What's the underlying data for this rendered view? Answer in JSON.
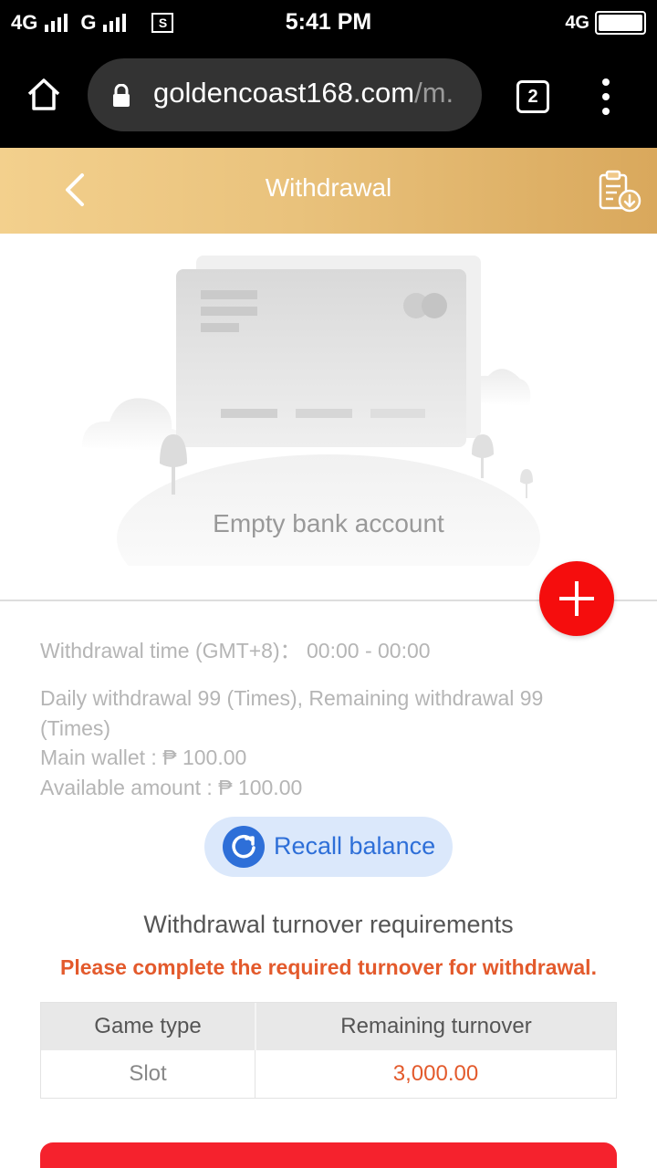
{
  "status_bar": {
    "net1": "4G",
    "net2": "G",
    "sim_label": "S",
    "time": "5:41 PM",
    "net_right": "4G"
  },
  "browser": {
    "url_main": "goldencoast168.com",
    "url_tail": "/m.",
    "tab_count": "2",
    "icons": [
      "home-icon",
      "lock-icon",
      "tabs-icon",
      "more-vert-icon"
    ]
  },
  "header": {
    "title": "Withdrawal",
    "icons": [
      "chevron-left-icon",
      "clipboard-download-icon"
    ],
    "gradient": [
      "#f3d08d",
      "#d9a85c"
    ]
  },
  "empty_state": {
    "text": "Empty bank account"
  },
  "add_button": {
    "icon": "plus-icon",
    "color": "#f50d0d"
  },
  "info": {
    "withdrawal_time": "Withdrawal time (GMT+8)：  00:00 - 00:00",
    "daily_limit": "Daily withdrawal 99 (Times), Remaining withdrawal 99 (Times)",
    "main_wallet": "Main wallet : ₱ 100.00",
    "available_amount": "Available amount : ₱ 100.00"
  },
  "recall": {
    "label": "Recall balance",
    "icon": "refresh-icon",
    "color": "#2e6fd8"
  },
  "turnover": {
    "title": "Withdrawal turnover requirements",
    "note": "Please complete the required turnover for withdrawal.",
    "headers": [
      "Game type",
      "Remaining turnover"
    ],
    "rows": [
      {
        "game_type": "Slot",
        "remaining": "3,000.00"
      }
    ]
  },
  "colors": {
    "accent_red": "#f5222d",
    "note_orange": "#e35a2c"
  }
}
